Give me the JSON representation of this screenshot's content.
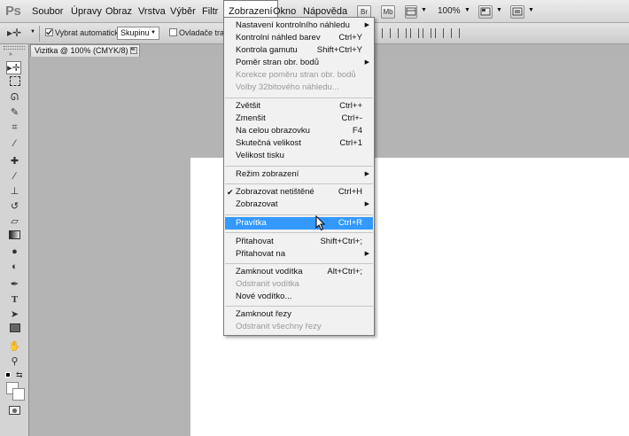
{
  "app": {
    "logo": "Ps"
  },
  "menubar": {
    "items": [
      "Soubor",
      "Úpravy",
      "Obraz",
      "Vrstva",
      "Výběr",
      "Filtr",
      "Zobrazení",
      "Okno",
      "Nápověda"
    ],
    "buttons": {
      "bridge": "Br",
      "minibridge": "Mb"
    },
    "zoom": "100%"
  },
  "options": {
    "auto_select_label": "Vybrat automaticky:",
    "auto_select_value": "Skupinu",
    "transform_label": "Ovladače trans"
  },
  "document": {
    "tab_title": "Vizitka @ 100% (CMYK/8) *",
    "close_symbol": "×"
  },
  "view_menu": {
    "items": [
      {
        "label": "Nastavení kontrolního náhledu",
        "shortcut": "",
        "submenu": true
      },
      {
        "label": "Kontrolní náhled barev",
        "shortcut": "Ctrl+Y"
      },
      {
        "label": "Kontrola gamutu",
        "shortcut": "Shift+Ctrl+Y"
      },
      {
        "label": "Poměr stran obr. bodů",
        "shortcut": "",
        "submenu": true
      },
      {
        "label": "Korekce poměru stran obr. bodů",
        "shortcut": "",
        "disabled": true
      },
      {
        "label": "Volby 32bitového náhledu...",
        "shortcut": "",
        "disabled": true
      },
      {
        "label": "Zvětšit",
        "shortcut": "Ctrl++"
      },
      {
        "label": "Zmenšit",
        "shortcut": "Ctrl+-"
      },
      {
        "label": "Na celou obrazovku",
        "shortcut": "F4"
      },
      {
        "label": "Skutečná velikost",
        "shortcut": "Ctrl+1"
      },
      {
        "label": "Velikost tisku",
        "shortcut": ""
      },
      {
        "label": "Režim zobrazení",
        "shortcut": "",
        "submenu": true
      },
      {
        "label": "Zobrazovat netištěné",
        "shortcut": "Ctrl+H",
        "checked": true
      },
      {
        "label": "Zobrazovat",
        "shortcut": "",
        "submenu": true
      },
      {
        "label": "Pravítka",
        "shortcut": "Ctrl+R",
        "highlighted": true
      },
      {
        "label": "Přitahovat",
        "shortcut": "Shift+Ctrl+;"
      },
      {
        "label": "Přitahovat na",
        "shortcut": "",
        "submenu": true
      },
      {
        "label": "Zamknout vodítka",
        "shortcut": "Alt+Ctrl+;"
      },
      {
        "label": "Odstranit vodítka",
        "shortcut": "",
        "disabled": true
      },
      {
        "label": "Nové vodítko...",
        "shortcut": ""
      },
      {
        "label": "Zamknout řezy",
        "shortcut": ""
      },
      {
        "label": "Odstranit všechny řezy",
        "shortcut": "",
        "disabled": true
      }
    ],
    "check_symbol": "✔",
    "submenu_symbol": "▶"
  },
  "colors": {
    "highlight": "#3399ff",
    "workspace": "#b3b3b3"
  }
}
